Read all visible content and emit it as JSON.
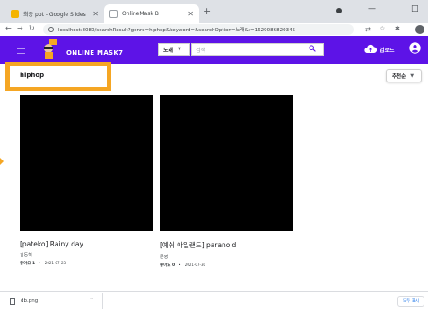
{
  "browser": {
    "tabs": [
      {
        "title": "최종 ppt - Google Slides",
        "favicon": "slides-icon",
        "active": false
      },
      {
        "title": "OnlineMask B",
        "favicon": "site-icon",
        "active": true
      }
    ],
    "new_tab_glyph": "+",
    "address": "localhost:8080/searchResult?genre=hiphop&keyword=&searchOption=노래&t=1629086820345",
    "window_controls": {
      "minimize": "—",
      "maximize": "□"
    }
  },
  "header": {
    "brand": "ONLINE MASK7",
    "search_option": "노래",
    "search_placeholder": "검색",
    "upload_label": "업로드",
    "colors": {
      "primary": "#5d13e7",
      "highlight": "#f5a623"
    }
  },
  "page": {
    "genre_title": "hiphop",
    "sort_label": "추천순"
  },
  "songs": [
    {
      "title": "[pateko] Rainy day",
      "artist": "김동혁",
      "likes": "좋아요 1",
      "date": "2021-07-23"
    },
    {
      "title": "[예쉬 아일랜드] paranoid",
      "artist": "준영",
      "likes": "좋아요 0",
      "date": "2021-07-30"
    }
  ],
  "downloads": {
    "file_name": "db.png",
    "show_all": "모두 표시"
  }
}
